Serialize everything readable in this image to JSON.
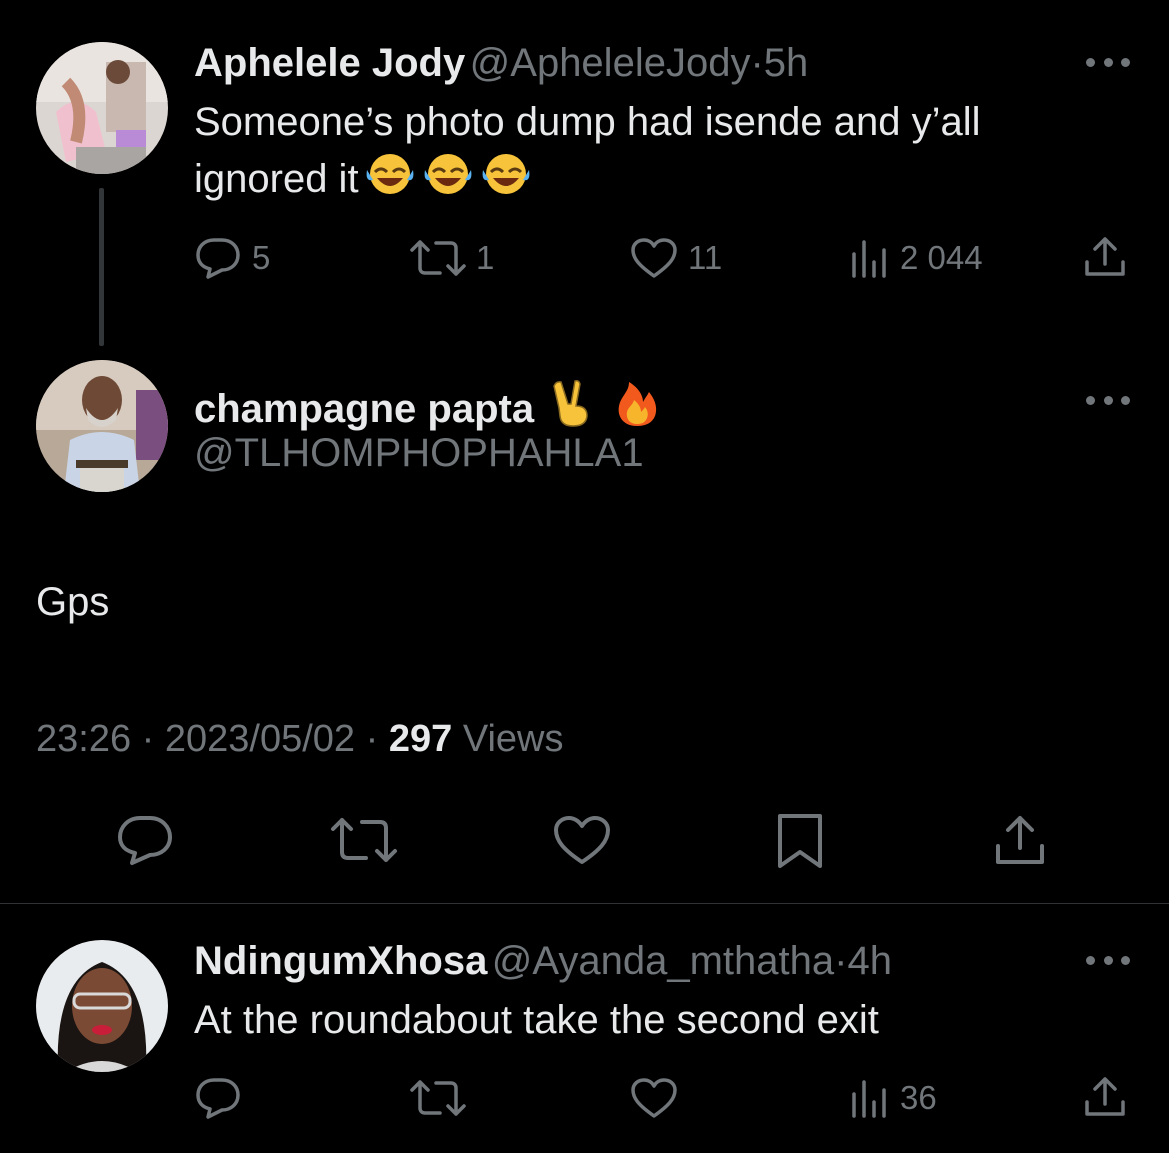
{
  "tweet1": {
    "display_name": "Aphelele Jody",
    "handle": "@ApheleleJody",
    "separator": "·",
    "time": "5h",
    "text_line1": "Someone’s photo dump had isende and y’all",
    "text_line2": "ignored it",
    "emojis": [
      "face-with-tears-of-joy",
      "face-with-tears-of-joy",
      "face-with-tears-of-joy"
    ],
    "replies": "5",
    "retweets": "1",
    "likes": "11",
    "views": "2 044"
  },
  "tweet2": {
    "display_name": "champagne papta",
    "name_emojis": [
      "victory-hand",
      "fire"
    ],
    "handle": "@TLHOMPHOPHAHLA1",
    "text": "Gps",
    "time": "23:26",
    "sep1": "·",
    "date": "2023/05/02",
    "sep2": "·",
    "views_count": "297",
    "views_label": "Views"
  },
  "tweet3": {
    "display_name": "NdingumXhosa",
    "handle": "@Ayanda_mthatha",
    "separator": "·",
    "time": "4h",
    "text": "At the roundabout take the second exit",
    "views": "36"
  },
  "colors": {
    "background": "#000000",
    "primary_text": "#e7e9ea",
    "secondary_text": "#71767b",
    "divider": "#2f3336"
  }
}
